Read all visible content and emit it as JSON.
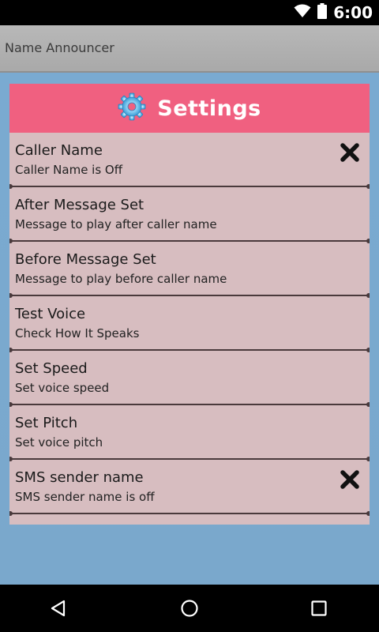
{
  "status_bar": {
    "time": "6:00",
    "icons": [
      "wifi-icon",
      "battery-icon"
    ]
  },
  "action_bar": {
    "title": "Name Announcer"
  },
  "settings": {
    "header_icon": "gear-icon",
    "title": "Settings",
    "items": [
      {
        "title": "Caller Name",
        "subtitle": "Caller Name is Off",
        "status_icon": "close-icon"
      },
      {
        "title": "After Message Set",
        "subtitle": "Message to play after caller name"
      },
      {
        "title": "Before Message Set",
        "subtitle": "Message to play before caller name"
      },
      {
        "title": "Test Voice",
        "subtitle": "Check How It Speaks"
      },
      {
        "title": "Set Speed",
        "subtitle": "Set voice speed"
      },
      {
        "title": "Set Pitch",
        "subtitle": "Set voice pitch"
      },
      {
        "title": "SMS sender name",
        "subtitle": "SMS sender name is off",
        "status_icon": "close-icon"
      }
    ]
  },
  "nav_bar": {
    "icons": [
      "back-icon",
      "home-icon",
      "recents-icon"
    ]
  },
  "colors": {
    "header": "#f06080",
    "panel": "#d7bdc0",
    "background": "#7aa9cf"
  }
}
